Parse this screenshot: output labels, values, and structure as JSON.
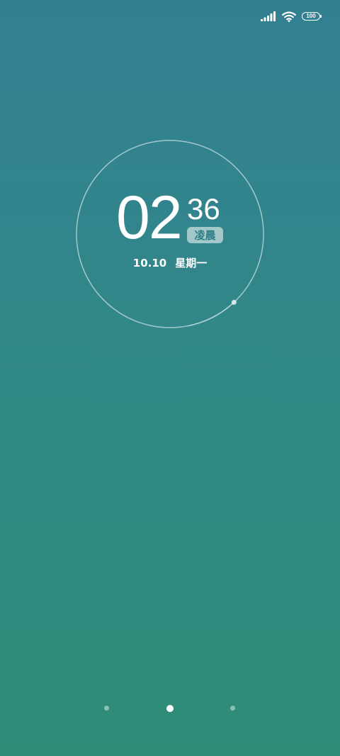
{
  "status_bar": {
    "signal_icon": "signal-bars-icon",
    "wifi_icon": "wifi-icon",
    "battery_level": "100",
    "battery_percent": 100,
    "battery_icon": "battery-icon"
  },
  "clock": {
    "hour": "02",
    "minute": "36",
    "period": "凌晨",
    "date": "10.10",
    "weekday": "星期一",
    "seconds_progress": 0.38
  },
  "pager": {
    "page_count": 3,
    "active_page": 2
  },
  "colors": {
    "background_top": "#337f92",
    "background_bottom": "#2e8c77",
    "text": "#ffffff",
    "badge_text": "#2d7b87"
  }
}
